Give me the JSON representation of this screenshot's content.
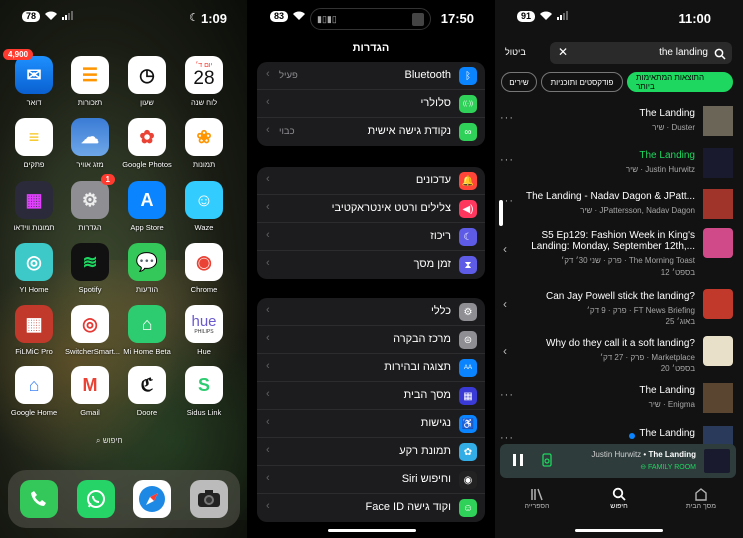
{
  "home": {
    "status": {
      "battery": "78",
      "time": "1:09"
    },
    "apps": [
      {
        "label": "דואר",
        "badge": "4,900"
      },
      {
        "label": "תזכורות"
      },
      {
        "label": "שעון"
      },
      {
        "label": "לוח שנה",
        "day": "יום ד׳",
        "date": "28"
      },
      {
        "label": "פתקים"
      },
      {
        "label": "מזג אוויר"
      },
      {
        "label": "Google Photos"
      },
      {
        "label": "תמונות"
      },
      {
        "label": "תמונות ווידאו"
      },
      {
        "label": "הגדרות",
        "badge": "1"
      },
      {
        "label": "App Store"
      },
      {
        "label": "Waze"
      },
      {
        "label": "YI Home"
      },
      {
        "label": "Spotify"
      },
      {
        "label": "הודעות"
      },
      {
        "label": "Chrome"
      },
      {
        "label": "FiLMiC Pro"
      },
      {
        "label": "SwitcherSmart..."
      },
      {
        "label": "Mi Home Beta"
      },
      {
        "label": "Hue",
        "brand": "hue",
        "sub": "PHILIPS"
      },
      {
        "label": "Google Home"
      },
      {
        "label": "Gmail"
      },
      {
        "label": "Doore"
      },
      {
        "label": "Sidus Link"
      }
    ],
    "search_label": "חיפוש",
    "dock": [
      "phone-icon",
      "whatsapp-icon",
      "safari-icon",
      "camera-icon"
    ]
  },
  "settings": {
    "status": {
      "battery": "83",
      "time": "17:50"
    },
    "title": "הגדרות",
    "groups": [
      [
        {
          "label": "Bluetooth",
          "value": "פעיל",
          "color": "#0a84ff",
          "icon": "bluetooth-icon"
        },
        {
          "label": "סלולרי",
          "value": "",
          "color": "#30d158",
          "icon": "cellular-icon"
        },
        {
          "label": "נקודת גישה אישית",
          "value": "כבוי",
          "color": "#30d158",
          "icon": "hotspot-icon"
        }
      ],
      [
        {
          "label": "עדכונים",
          "value": "",
          "color": "#ff453a",
          "icon": "bell-icon"
        },
        {
          "label": "צלילים ורטט אינטראקטיבי",
          "value": "",
          "color": "#ff375f",
          "icon": "speaker-icon"
        },
        {
          "label": "ריכוז",
          "value": "",
          "color": "#5e5ce6",
          "icon": "moon-icon"
        },
        {
          "label": "זמן מסך",
          "value": "",
          "color": "#5e5ce6",
          "icon": "hourglass-icon"
        }
      ],
      [
        {
          "label": "כללי",
          "value": "",
          "color": "#8e8e93",
          "icon": "gear-icon"
        },
        {
          "label": "מרכז הבקרה",
          "value": "",
          "color": "#8e8e93",
          "icon": "toggles-icon"
        },
        {
          "label": "תצוגה ובהירות",
          "value": "",
          "color": "#0a84ff",
          "icon": "display-icon"
        },
        {
          "label": "מסך הבית",
          "value": "",
          "color": "#3a3ad6",
          "icon": "grid-icon"
        },
        {
          "label": "נגישות",
          "value": "",
          "color": "#0a84ff",
          "icon": "accessibility-icon"
        },
        {
          "label": "תמונת רקע",
          "value": "",
          "color": "#32ade6",
          "icon": "flower-icon"
        },
        {
          "label": "Siri וחיפוש",
          "value": "",
          "color": "#222",
          "icon": "siri-icon"
        },
        {
          "label": "Face ID וקוד גישה",
          "value": "",
          "color": "#30d158",
          "icon": "faceid-icon"
        }
      ]
    ]
  },
  "spotify": {
    "status": {
      "battery": "91",
      "time": "11:00"
    },
    "query": "the landing",
    "cancel_label": "ביטול",
    "chips": [
      "התוצאות המתאימות ביותר",
      "פודקסטים ותוכניות",
      "שירים"
    ],
    "tracks": [
      {
        "title": "The Landing",
        "sub": "שיר · Duster",
        "green": false,
        "art": "#6b6558"
      },
      {
        "title": "The Landing",
        "sub": "שיר · Justin Hurwitz",
        "green": true,
        "art": "#1a1a2e"
      },
      {
        "title": "The Landing - Nadav Dagon & JPatt...",
        "sub": "שיר · JPattersson, Nadav Dagon",
        "green": false,
        "art": "#a0332a"
      },
      {
        "title": "S5 Ep129: Fashion Week in King's Landing: Monday, September 12th,...",
        "sub": "פרק · שני 30׳ דק׳ · The Morning Toast",
        "date": "12 בספט׳",
        "green": false,
        "art": "#d04a8a"
      },
      {
        "title": "Can Jay Powell stick the landing?",
        "sub": "פרק · 9 דק׳ · FT News Briefing",
        "date": "25 באוג׳",
        "green": false,
        "art": "#c0392b"
      },
      {
        "title": "Why do they call it a soft landing?",
        "sub": "פרק · 27 דק׳ · Marketplace",
        "date": "20 בספט׳",
        "green": false,
        "art": "#e8e0c8"
      },
      {
        "title": "The Landing",
        "sub": "שיר · Enigma",
        "green": false,
        "art": "#5a4630"
      },
      {
        "title": "The Landing",
        "sub": "",
        "green": false,
        "art": "#2a3a5a"
      }
    ],
    "player": {
      "title": "The Landing",
      "artist": "Justin Hurwitz",
      "device": "FAMILY ROOM"
    },
    "nav": [
      "מסך הבית",
      "חיפוש",
      "הספרייה"
    ]
  }
}
